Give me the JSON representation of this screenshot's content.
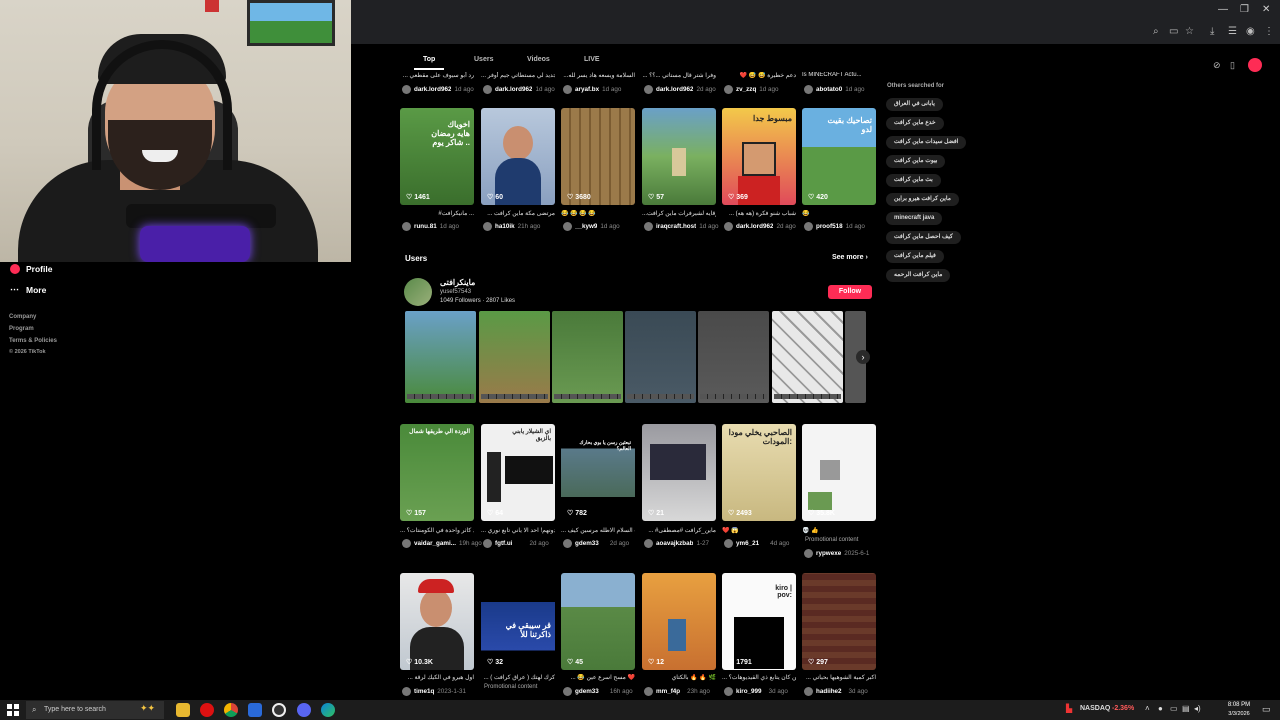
{
  "window": {
    "minimize": "—",
    "restore": "❐",
    "close": "✕"
  },
  "sidebar": {
    "profile_label": "Profile",
    "more_label": "More",
    "footer": [
      "Company",
      "Program",
      "Terms & Policies"
    ],
    "copyright": "© 2026 TikTok"
  },
  "tabs": [
    "Top",
    "Users",
    "Videos",
    "LIVE"
  ],
  "row1": [
    {
      "caption": "... رد أبو سيوف على مقطعي",
      "user": "dark.lord962",
      "date": "1d ago"
    },
    {
      "caption": "... جديد لي مستطاتي جيم أوفر",
      "user": "dark.lord962",
      "date": "1d ago"
    },
    {
      "caption": "...السلامة ويسعه هاد يسر لله",
      "user": "aryaf.bx",
      "date": "1d ago"
    },
    {
      "caption": "... وفرا شتر قال مستاتي ...؟؟",
      "user": "dark.lord962",
      "date": "2d ago"
    },
    {
      "caption": "❤️ 😅 😅 دعم خطيرة",
      "user": "zv_zzq",
      "date": "1d ago"
    },
    {
      "caption": "Is MINECRAFT Actu...",
      "user": "abotato0",
      "date": "1d ago"
    }
  ],
  "row2": [
    {
      "likes": "1461",
      "overlay": "اخوياك\nهايه رمضان\nشاكر يوم ..",
      "caption": "#مانیکرافت ...",
      "user": "runu.81",
      "date": "1d ago"
    },
    {
      "likes": "60",
      "overlay": "",
      "caption": "... مرتضى مكة ماين كرافت",
      "user": "ha10ik",
      "date": "21h ago"
    },
    {
      "likes": "3680",
      "overlay": "",
      "caption": "😂 😂 😂 😂",
      "user": "__kyw9",
      "date": "1d ago"
    },
    {
      "likes": "57",
      "overlay": "",
      "caption": "...رقايه لشيرفرات ماين كرافت",
      "user": "iraqcraft.host",
      "date": "1d ago"
    },
    {
      "likes": "369",
      "overlay": "مبسوط جدا",
      "caption": "... شباب شنو فكرة (هه هه)",
      "user": "dark.lord962",
      "date": "2d ago"
    },
    {
      "likes": "420",
      "overlay": "تصاحيك بقيت\nلدو",
      "caption": "😂",
      "user": "proof518",
      "date": "1d ago"
    }
  ],
  "users_section": {
    "heading": "Users",
    "see_more": "See more",
    "display_name": "ماینکرافتی",
    "handle": "yusef57543",
    "stats": "1049 Followers · 2807 Likes",
    "follow": "Follow"
  },
  "row3": [
    {
      "likes": "157",
      "overlay": "الوردة الي طريقها شمال",
      "caption": "... قد كأثر واحدة في الكومنتات؟",
      "user": "vaidar_gami...",
      "date": "19h ago"
    },
    {
      "likes": "64",
      "overlay": "اي الشيلار يابني\nبالزبق",
      "caption": "... دونهم! احد الا ياني تابع نوري",
      "user": "fgtf.ui",
      "date": "2d ago"
    },
    {
      "likes": "782",
      "overlay": "تبعثين رسن يا بوي بحارك العالم؟",
      "caption": "... برنت السلام الاطله مرسين كيف",
      "user": "gdem33",
      "date": "2d ago"
    },
    {
      "likes": "21",
      "overlay": "",
      "caption": "... #ماين_كرافت #مصطفى",
      "user": "aoavajkzbab",
      "date": "1-27"
    },
    {
      "likes": "2493",
      "overlay": "الصاحبي يخلي مودا\nالمودات:",
      "caption": "❤️ 😱",
      "user": "ym6_21",
      "date": "4d ago"
    },
    {
      "likes": "35.8K",
      "overlay": "",
      "caption": "💀 👍",
      "user": "rypwexe",
      "date": "2025-6-1",
      "promo": "Promotional content"
    }
  ],
  "row4": [
    {
      "likes": "10.3K",
      "overlay": "",
      "caption": "... اول هيرو في الكيك لرقة",
      "user": "time1q",
      "date": "2023-1-31"
    },
    {
      "likes": "32",
      "overlay": "قر سيبقى في ذاكرتنا للأ",
      "caption": "... كرك لهتك ( عراق كرافت )",
      "user": "fgtf.ui",
      "date": "",
      "promo": "Promotional content"
    },
    {
      "likes": "45",
      "overlay": "",
      "caption": "... 😂 مسح اسرع عين ❤️",
      "user": "gdem33",
      "date": "16h ago"
    },
    {
      "likes": "12",
      "overlay": "",
      "caption": "بالكتاي 🔥 🔥 🌿",
      "user": "mm_f4p",
      "date": "23h ago"
    },
    {
      "likes": "1791",
      "overlay": "kiro |\npov:",
      "caption": "... من كان يتابع ذي القيديوهات؟",
      "user": "kiro_999",
      "date": "3d ago"
    },
    {
      "likes": "297",
      "overlay": "",
      "caption": "... اكبر كمية الشوهيها بحياتي",
      "user": "hadiihe2",
      "date": "3d ago"
    }
  ],
  "others_searched": {
    "title": "Others searched for",
    "items": [
      "يابانی في العراق",
      "خدع ماين كرافت",
      "افضل سيدات ماين كرافت",
      "بيوت ماين كرافت",
      "بث ماين كرافت",
      "ماين كرافت هيرو براين",
      "minecraft java",
      "كيف احصل ماين كرافت",
      "فيلم ماين كرافت",
      "ماين كرافت الرحمه"
    ]
  },
  "taskbar": {
    "search_placeholder": "Type here to search",
    "ticker_name": "NASDAQ",
    "ticker_change": "-2.36%",
    "time": "8:08 PM",
    "date": "3/3/2026"
  },
  "colors": {
    "accent": "#fe2c55",
    "ticker_down": "#ff5a5a"
  }
}
